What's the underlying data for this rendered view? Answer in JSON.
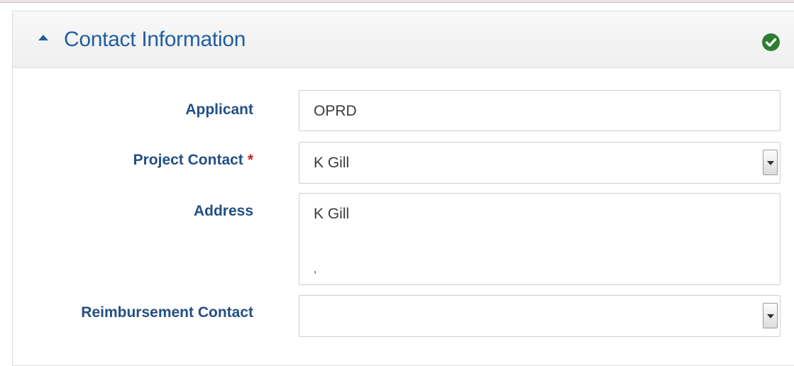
{
  "panel": {
    "title": "Contact Information",
    "status_color": "#2e7d32"
  },
  "fields": {
    "applicant": {
      "label": "Applicant",
      "value": "OPRD"
    },
    "project_contact": {
      "label": "Project Contact",
      "required_mark": "*",
      "value": "K Gill"
    },
    "address": {
      "label": "Address",
      "line1": "K Gill",
      "line2": ","
    },
    "reimbursement_contact": {
      "label": "Reimbursement Contact",
      "value": ""
    }
  }
}
